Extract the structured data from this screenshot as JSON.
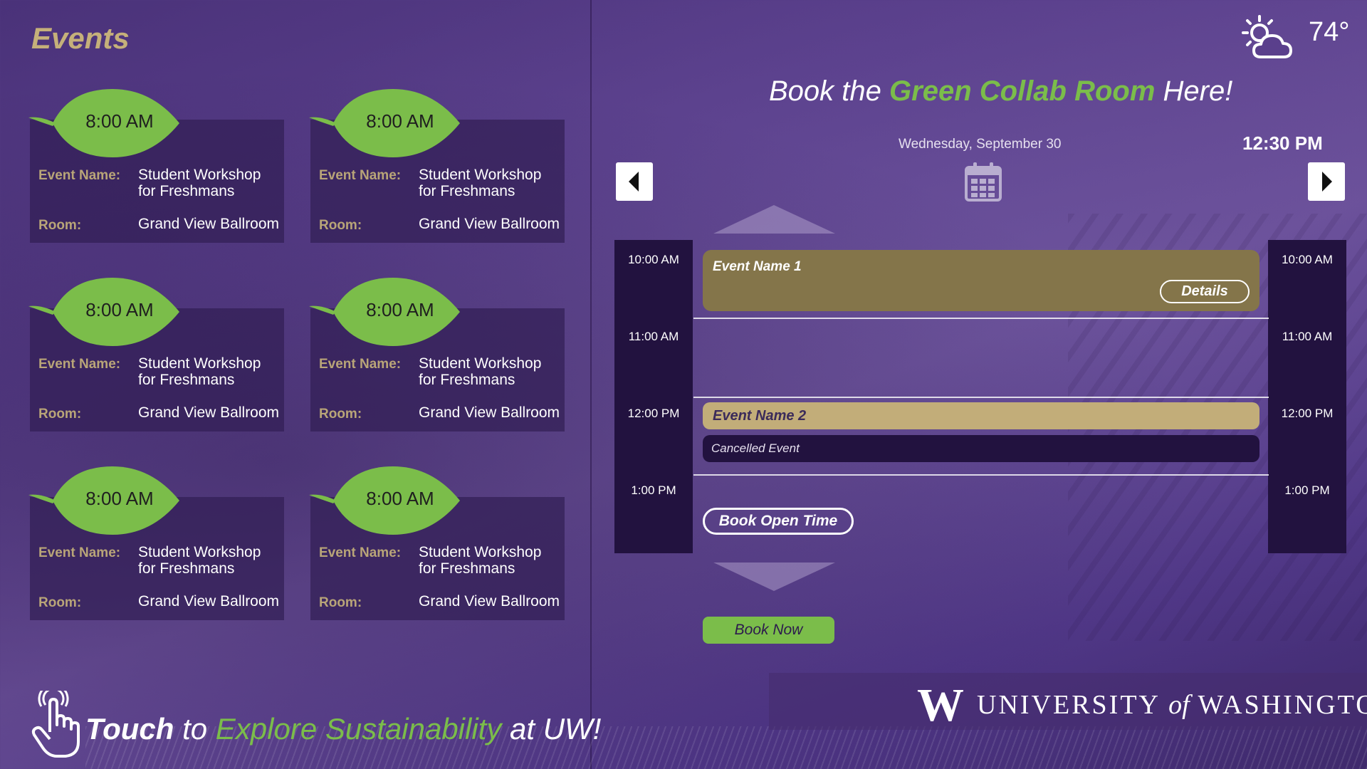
{
  "events_panel": {
    "title": "Events",
    "cards": [
      {
        "time": "8:00 AM",
        "event_label": "Event Name:",
        "event_value": "Student Workshop for Freshmans",
        "room_label": "Room:",
        "room_value": "Grand View Ballroom"
      },
      {
        "time": "8:00 AM",
        "event_label": "Event Name:",
        "event_value": "Student Workshop for Freshmans",
        "room_label": "Room:",
        "room_value": "Grand View Ballroom"
      },
      {
        "time": "8:00 AM",
        "event_label": "Event Name:",
        "event_value": "Student Workshop for Freshmans",
        "room_label": "Room:",
        "room_value": "Grand View Ballroom"
      },
      {
        "time": "8:00 AM",
        "event_label": "Event Name:",
        "event_value": "Student Workshop for Freshmans",
        "room_label": "Room:",
        "room_value": "Grand View Ballroom"
      },
      {
        "time": "8:00 AM",
        "event_label": "Event Name:",
        "event_value": "Student Workshop for Freshmans",
        "room_label": "Room:",
        "room_value": "Grand View Ballroom"
      },
      {
        "time": "8:00 AM",
        "event_label": "Event Name:",
        "event_value": "Student Workshop for Freshmans",
        "room_label": "Room:",
        "room_value": "Grand View Ballroom"
      }
    ]
  },
  "touch_banner": {
    "touch": "Touch",
    "to": "to",
    "explore": "Explore Sustainability",
    "at": "at UW!"
  },
  "weather": {
    "icon": "partly-cloudy-icon",
    "temperature": "74°"
  },
  "booking": {
    "title_prefix": "Book the",
    "room_name": "Green Collab Room",
    "title_suffix": "Here!",
    "date": "Wednesday, September 30",
    "current_time": "12:30 PM",
    "time_labels": [
      "10:00 AM",
      "11:00 AM",
      "12:00 PM",
      "1:00 PM"
    ],
    "events": [
      {
        "name": "Event Name 1",
        "action": "Details"
      },
      {
        "name": "Event Name 2",
        "status": "Cancelled Event"
      }
    ],
    "open_time_button": "Book Open Time",
    "book_now_button": "Book Now"
  },
  "branding": {
    "w": "W",
    "university": "UNIVERSITY",
    "of": "of",
    "washington": "WASHINGTON"
  },
  "colors": {
    "accent_green": "#7bbd4a",
    "gold": "#c5b07a",
    "event_brown": "#84754a",
    "dark_purple": "#22123f"
  }
}
